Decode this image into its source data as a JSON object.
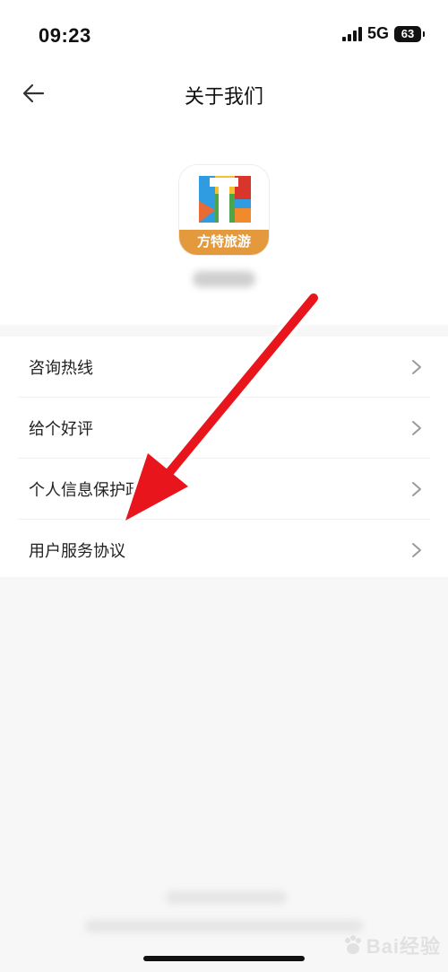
{
  "status_bar": {
    "time": "09:23",
    "network": "5G",
    "battery": "63"
  },
  "nav": {
    "title": "关于我们"
  },
  "app": {
    "icon_letter": "T",
    "icon_caption": "方特旅游"
  },
  "menu": {
    "items": [
      {
        "label": "咨询热线"
      },
      {
        "label": "给个好评"
      },
      {
        "label": "个人信息保护政策"
      },
      {
        "label": "用户服务协议"
      }
    ]
  },
  "watermark": {
    "text": "Bai经验"
  },
  "colors": {
    "arrow": "#e8141c",
    "icon_orange": "#e49a3c"
  }
}
